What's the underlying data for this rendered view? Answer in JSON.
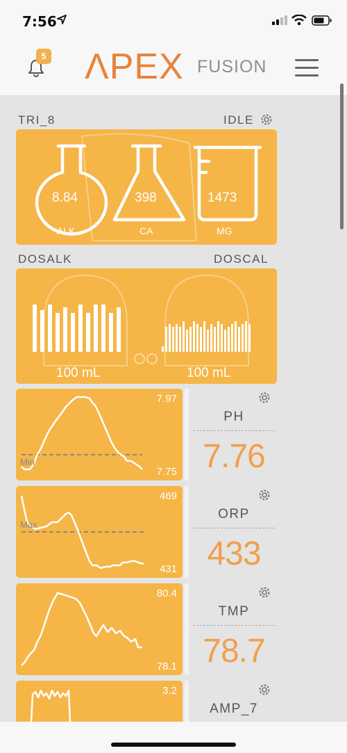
{
  "status_bar": {
    "time": "7:56"
  },
  "header": {
    "notification_count": "5",
    "logo_main": "ΛPEX",
    "logo_sub": "FUSION"
  },
  "trident": {
    "name": "TRI_8",
    "state": "IDLE",
    "alk": {
      "value": "8.84",
      "label": "ALK"
    },
    "ca": {
      "value": "398",
      "label": "CA"
    },
    "mg": {
      "value": "1473",
      "label": "MG"
    }
  },
  "dosing": {
    "left_name": "DOSALK",
    "right_name": "DOSCAL",
    "left_volume": "100 mL",
    "right_volume": "100 mL",
    "left_bars": [
      0.85,
      0.75,
      0.85,
      0.7,
      0.8,
      0.7,
      0.85,
      0.7,
      0.85,
      0.85,
      0.7,
      0.8
    ],
    "right_bars": [
      0.1,
      0.45,
      0.5,
      0.45,
      0.5,
      0.45,
      0.55,
      0.4,
      0.45,
      0.55,
      0.5,
      0.45,
      0.55,
      0.4,
      0.5,
      0.45,
      0.55,
      0.5,
      0.4,
      0.45,
      0.5,
      0.55,
      0.45,
      0.5,
      0.55,
      0.5
    ]
  },
  "probes": [
    {
      "name": "PH",
      "value": "7.76",
      "max": "7.97",
      "min": "7.75",
      "threshold_label": "Min"
    },
    {
      "name": "ORP",
      "value": "433",
      "max": "469",
      "min": "431",
      "threshold_label": "Max"
    },
    {
      "name": "TMP",
      "value": "78.7",
      "max": "80.4",
      "min": "78.1",
      "threshold_label": ""
    },
    {
      "name": "AMP_7",
      "value": "",
      "max": "3.2",
      "min": "",
      "threshold_label": ""
    }
  ],
  "colors": {
    "card": "#f5b547",
    "accent": "#e8833a",
    "value": "#f0a04c"
  }
}
